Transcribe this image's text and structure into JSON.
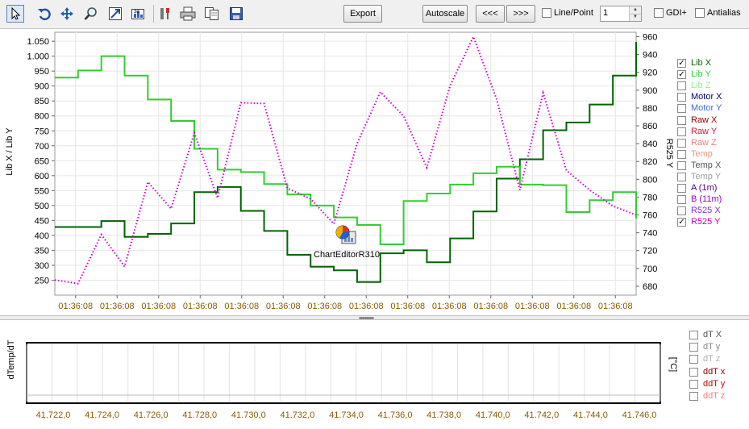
{
  "toolbar": {
    "icons": [
      "pointer-icon",
      "undo-icon",
      "move-icon",
      "zoom-icon",
      "scale-icon",
      "edit-chart-icon",
      "tools-icon",
      "print-icon",
      "copy-icon",
      "save-icon"
    ],
    "export_label": "Export",
    "autoscale_label": "Autoscale",
    "prev_label": "<<<",
    "next_label": ">>>",
    "linepoint_label": "Line/Point",
    "linepoint_checked": false,
    "point_size": "1",
    "gdi_label": "GDI+",
    "gdi_checked": false,
    "antialias_label": "Antialias",
    "antialias_checked": false
  },
  "overlay": {
    "editor_label": "ChartEditorR310"
  },
  "top_legend": [
    {
      "label": "Lib X",
      "color": "#006400",
      "checked": true
    },
    {
      "label": "Lib Y",
      "color": "#32cd32",
      "checked": true
    },
    {
      "label": "Lib Z",
      "color": "#90ee90",
      "checked": false
    },
    {
      "label": "Motor X",
      "color": "#000080",
      "checked": false
    },
    {
      "label": "Motor Y",
      "color": "#4169e1",
      "checked": false
    },
    {
      "label": "Raw X",
      "color": "#8b0000",
      "checked": false
    },
    {
      "label": "Raw Y",
      "color": "#dc143c",
      "checked": false
    },
    {
      "label": "Raw Z",
      "color": "#f08080",
      "checked": false
    },
    {
      "label": "Temp",
      "color": "#e9967a",
      "checked": false
    },
    {
      "label": "Temp X",
      "color": "#555555",
      "checked": false
    },
    {
      "label": "Temp Y",
      "color": "#a0a0a0",
      "checked": false
    },
    {
      "label": "A (1m)",
      "color": "#4b0082",
      "checked": false
    },
    {
      "label": "B (11m)",
      "color": "#9400d3",
      "checked": false
    },
    {
      "label": "R525 X",
      "color": "#8a2be2",
      "checked": false
    },
    {
      "label": "R525 Y",
      "color": "#cc00cc",
      "checked": true
    }
  ],
  "bottom_legend": [
    {
      "label": "dT X",
      "color": "#555555",
      "checked": false
    },
    {
      "label": "dT y",
      "color": "#888888",
      "checked": false
    },
    {
      "label": "dT z",
      "color": "#b0b0b0",
      "checked": false
    },
    {
      "label": "ddT x",
      "color": "#8b0000",
      "checked": false
    },
    {
      "label": "ddT y",
      "color": "#cc0000",
      "checked": false
    },
    {
      "label": "ddT z",
      "color": "#f08080",
      "checked": false
    }
  ],
  "chart_data": [
    {
      "type": "line",
      "ylabel": "Lib X / Lib Y",
      "y2label": "R525 Y",
      "ylim": [
        200,
        1080
      ],
      "y2lim": [
        670,
        965
      ],
      "yticks": [
        250,
        300,
        350,
        400,
        450,
        500,
        550,
        600,
        650,
        700,
        750,
        800,
        850,
        900,
        950,
        1000,
        1050
      ],
      "yticklabels": [
        "250",
        "300",
        "350",
        "400",
        "450",
        "500",
        "550",
        "600",
        "650",
        "700",
        "750",
        "800",
        "850",
        "900",
        "950",
        "1.000",
        "1.050"
      ],
      "y2ticks": [
        680,
        700,
        720,
        740,
        760,
        780,
        800,
        820,
        840,
        860,
        880,
        900,
        920,
        940,
        960
      ],
      "x_ticklabels": [
        "01:36:08",
        "01:36:08",
        "01:36:08",
        "01:36:08",
        "01:36:08",
        "01:36:08",
        "01:36:08",
        "01:36:08",
        "01:36:08",
        "01:36:08",
        "01:36:08",
        "01:36:08",
        "01:36:08",
        "01:36:08"
      ],
      "grid": true,
      "legend_position": "right",
      "series": [
        {
          "name": "Lib X",
          "axis": "left",
          "style": "step",
          "color": "#006400",
          "values": [
            428,
            428,
            448,
            395,
            405,
            440,
            545,
            562,
            482,
            415,
            335,
            295,
            283,
            244,
            340,
            350,
            310,
            390,
            480,
            590,
            655,
            752,
            778,
            838,
            935,
            1048
          ]
        },
        {
          "name": "Lib Y",
          "axis": "left",
          "style": "step",
          "color": "#32cd32",
          "values": [
            928,
            952,
            1000,
            935,
            855,
            783,
            690,
            620,
            612,
            572,
            537,
            500,
            460,
            435,
            370,
            515,
            540,
            570,
            608,
            630,
            570,
            568,
            478,
            518,
            545,
            456
          ]
        },
        {
          "name": "R525 Y",
          "axis": "right",
          "style": "dotted",
          "color": "#cc00cc",
          "values": [
            687,
            683,
            738,
            702,
            797,
            767,
            852,
            779,
            886,
            885,
            790,
            778,
            750,
            840,
            898,
            871,
            813,
            905,
            960,
            890,
            788,
            897,
            810,
            788,
            770,
            760
          ]
        }
      ]
    },
    {
      "type": "line",
      "ylabel": "dTemp/dT",
      "y2label": "[°C]",
      "xlim": [
        41.722,
        41.746
      ],
      "x_ticklabels": [
        "41.722,0",
        "41.724,0",
        "41.726,0",
        "41.728,0",
        "41.730,0",
        "41.732,0",
        "41.734,0",
        "41.736,0",
        "41.738,0",
        "41.740,0",
        "41.742,0",
        "41.744,0",
        "41.746,0"
      ],
      "grid": true,
      "legend_position": "right",
      "series": []
    }
  ]
}
